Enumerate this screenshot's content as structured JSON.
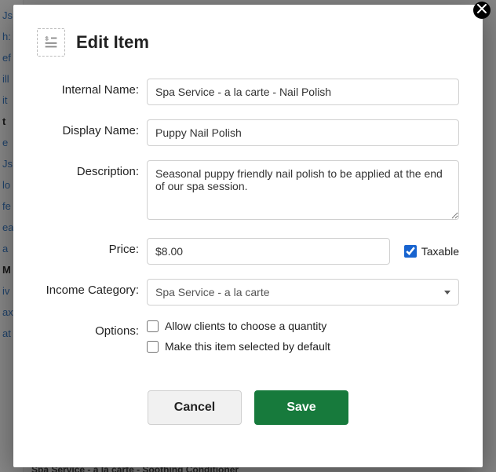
{
  "bg_sidebar_items": [
    {
      "text": "Js",
      "bold": false
    },
    {
      "text": "h:",
      "bold": false
    },
    {
      "text": "ef",
      "bold": false
    },
    {
      "text": "ill",
      "bold": false
    },
    {
      "text": "it",
      "bold": false
    },
    {
      "text": "t",
      "bold": true
    },
    {
      "text": "e",
      "bold": false
    },
    {
      "text": "Js",
      "bold": false
    },
    {
      "text": "lo",
      "bold": false
    },
    {
      "text": "fe",
      "bold": false
    },
    {
      "text": "ea",
      "bold": false
    },
    {
      "text": "a",
      "bold": false
    },
    {
      "text": "M",
      "bold": true
    },
    {
      "text": "iv",
      "bold": false
    },
    {
      "text": "ax",
      "bold": false
    },
    {
      "text": "at",
      "bold": false
    }
  ],
  "bg_bottom_text": "Spa Service - a la carte - Soothing Conditioner",
  "modal": {
    "title": "Edit Item",
    "labels": {
      "internal_name": "Internal Name:",
      "display_name": "Display Name:",
      "description": "Description:",
      "price": "Price:",
      "income_category": "Income Category:",
      "options": "Options:"
    },
    "fields": {
      "internal_name": "Spa Service - a la carte - Nail Polish",
      "display_name": "Puppy Nail Polish",
      "description": "Seasonal puppy friendly nail polish to be applied at the end of our spa session.",
      "price": "$8.00",
      "taxable_label": "Taxable",
      "taxable_checked": true,
      "income_category": "Spa Service - a la carte",
      "opt_quantity_label": "Allow clients to choose a quantity",
      "opt_quantity_checked": false,
      "opt_default_label": "Make this item selected by default",
      "opt_default_checked": false
    },
    "buttons": {
      "cancel": "Cancel",
      "save": "Save"
    }
  }
}
